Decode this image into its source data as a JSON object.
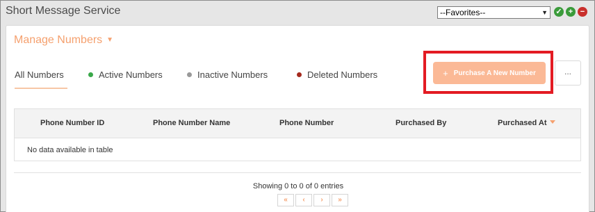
{
  "app": {
    "title": "Short Message Service"
  },
  "favorites": {
    "selected": "--Favorites--"
  },
  "section": {
    "title": "Manage Numbers"
  },
  "tabs": [
    {
      "label": "All Numbers",
      "dot_color": ""
    },
    {
      "label": "Active Numbers",
      "dot_color": "#3aa84a"
    },
    {
      "label": "Inactive Numbers",
      "dot_color": "#999999"
    },
    {
      "label": "Deleted Numbers",
      "dot_color": "#a52a1e"
    }
  ],
  "actions": {
    "purchase_label": "Purchase A New Number",
    "more_label": "..."
  },
  "table": {
    "columns": [
      "Phone Number ID",
      "Phone Number Name",
      "Phone Number",
      "Purchased By",
      "Purchased At"
    ],
    "empty_message": "No data available in table"
  },
  "pagination": {
    "info": "Showing 0 to 0 of 0 entries",
    "buttons": [
      "«",
      "‹",
      "›",
      "»"
    ]
  },
  "colors": {
    "accent": "#f5a06e",
    "button": "#fbb996",
    "highlight": "#e31b23"
  }
}
